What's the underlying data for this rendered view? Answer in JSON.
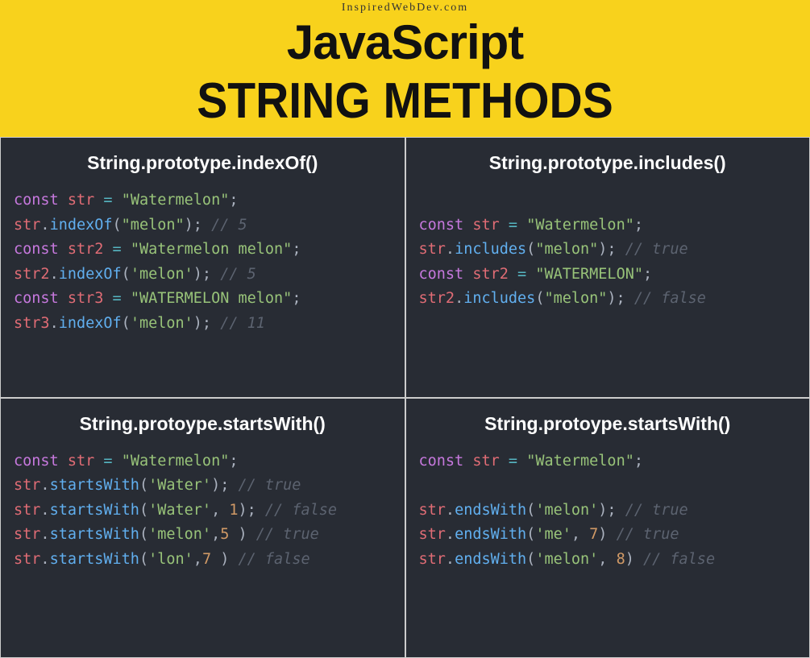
{
  "header": {
    "source": "InspiredWebDev.com",
    "title1": "JavaScript",
    "title2": "STRING METHODS"
  },
  "panels": [
    {
      "title": "String.prototype.indexOf()",
      "lines": [
        [
          [
            "kw",
            "const"
          ],
          [
            "punc",
            " "
          ],
          [
            "var",
            "str"
          ],
          [
            "punc",
            " "
          ],
          [
            "op",
            "="
          ],
          [
            "punc",
            " "
          ],
          [
            "str",
            "\"Watermelon\""
          ],
          [
            "punc",
            ";"
          ]
        ],
        [
          [
            "var",
            "str"
          ],
          [
            "punc",
            "."
          ],
          [
            "fn",
            "indexOf"
          ],
          [
            "punc",
            "("
          ],
          [
            "str",
            "\"melon\""
          ],
          [
            "punc",
            ");"
          ],
          [
            "punc",
            " "
          ],
          [
            "cmt",
            "// 5"
          ]
        ],
        [
          [
            "kw",
            "const"
          ],
          [
            "punc",
            " "
          ],
          [
            "var",
            "str2"
          ],
          [
            "punc",
            " "
          ],
          [
            "op",
            "="
          ],
          [
            "punc",
            " "
          ],
          [
            "str",
            "\"Watermelon melon\""
          ],
          [
            "punc",
            ";"
          ]
        ],
        [
          [
            "var",
            "str2"
          ],
          [
            "punc",
            "."
          ],
          [
            "fn",
            "indexOf"
          ],
          [
            "punc",
            "("
          ],
          [
            "str",
            "'melon'"
          ],
          [
            "punc",
            ");"
          ],
          [
            "punc",
            " "
          ],
          [
            "cmt",
            "// 5"
          ]
        ],
        [
          [
            "kw",
            "const"
          ],
          [
            "punc",
            " "
          ],
          [
            "var",
            "str3"
          ],
          [
            "punc",
            " "
          ],
          [
            "op",
            "="
          ],
          [
            "punc",
            " "
          ],
          [
            "str",
            "\"WATERMELON melon\""
          ],
          [
            "punc",
            ";"
          ]
        ],
        [
          [
            "var",
            "str3"
          ],
          [
            "punc",
            "."
          ],
          [
            "fn",
            "indexOf"
          ],
          [
            "punc",
            "("
          ],
          [
            "str",
            "'melon'"
          ],
          [
            "punc",
            ");"
          ],
          [
            "punc",
            " "
          ],
          [
            "cmt",
            "// 11"
          ]
        ]
      ]
    },
    {
      "title": "String.prototype.includes()",
      "lines": [
        [
          [
            "punc",
            ""
          ]
        ],
        [
          [
            "kw",
            "const"
          ],
          [
            "punc",
            " "
          ],
          [
            "var",
            "str"
          ],
          [
            "punc",
            " "
          ],
          [
            "op",
            "="
          ],
          [
            "punc",
            " "
          ],
          [
            "str",
            "\"Watermelon\""
          ],
          [
            "punc",
            ";"
          ]
        ],
        [
          [
            "var",
            "str"
          ],
          [
            "punc",
            "."
          ],
          [
            "fn",
            "includes"
          ],
          [
            "punc",
            "("
          ],
          [
            "str",
            "\"melon\""
          ],
          [
            "punc",
            ");"
          ],
          [
            "punc",
            " "
          ],
          [
            "cmt",
            "// true"
          ]
        ],
        [
          [
            "kw",
            "const"
          ],
          [
            "punc",
            " "
          ],
          [
            "var",
            "str2"
          ],
          [
            "punc",
            " "
          ],
          [
            "op",
            "="
          ],
          [
            "punc",
            " "
          ],
          [
            "str",
            "\"WATERMELON\""
          ],
          [
            "punc",
            ";"
          ]
        ],
        [
          [
            "var",
            "str2"
          ],
          [
            "punc",
            "."
          ],
          [
            "fn",
            "includes"
          ],
          [
            "punc",
            "("
          ],
          [
            "str",
            "\"melon\""
          ],
          [
            "punc",
            ");"
          ],
          [
            "punc",
            " "
          ],
          [
            "cmt",
            "// false"
          ]
        ]
      ]
    },
    {
      "title": "String.protoype.startsWith()",
      "lines": [
        [
          [
            "kw",
            "const"
          ],
          [
            "punc",
            " "
          ],
          [
            "var",
            "str"
          ],
          [
            "punc",
            " "
          ],
          [
            "op",
            "="
          ],
          [
            "punc",
            " "
          ],
          [
            "str",
            "\"Watermelon\""
          ],
          [
            "punc",
            ";"
          ]
        ],
        [
          [
            "var",
            "str"
          ],
          [
            "punc",
            "."
          ],
          [
            "fn",
            "startsWith"
          ],
          [
            "punc",
            "("
          ],
          [
            "str",
            "'Water'"
          ],
          [
            "punc",
            ");"
          ],
          [
            "punc",
            " "
          ],
          [
            "cmt",
            "// true"
          ]
        ],
        [
          [
            "var",
            "str"
          ],
          [
            "punc",
            "."
          ],
          [
            "fn",
            "startsWith"
          ],
          [
            "punc",
            "("
          ],
          [
            "str",
            "'Water'"
          ],
          [
            "punc",
            ", "
          ],
          [
            "num",
            "1"
          ],
          [
            "punc",
            ");"
          ],
          [
            "punc",
            " "
          ],
          [
            "cmt",
            "// false"
          ]
        ],
        [
          [
            "var",
            "str"
          ],
          [
            "punc",
            "."
          ],
          [
            "fn",
            "startsWith"
          ],
          [
            "punc",
            "("
          ],
          [
            "str",
            "'melon'"
          ],
          [
            "punc",
            ","
          ],
          [
            "num",
            "5"
          ],
          [
            "punc",
            " )"
          ],
          [
            "punc",
            " "
          ],
          [
            "cmt",
            "// true"
          ]
        ],
        [
          [
            "var",
            "str"
          ],
          [
            "punc",
            "."
          ],
          [
            "fn",
            "startsWith"
          ],
          [
            "punc",
            "("
          ],
          [
            "str",
            "'lon'"
          ],
          [
            "punc",
            ","
          ],
          [
            "num",
            "7"
          ],
          [
            "punc",
            " )"
          ],
          [
            "punc",
            " "
          ],
          [
            "cmt",
            "// false"
          ]
        ]
      ]
    },
    {
      "title": "String.protoype.startsWith()",
      "lines": [
        [
          [
            "kw",
            "const"
          ],
          [
            "punc",
            " "
          ],
          [
            "var",
            "str"
          ],
          [
            "punc",
            " "
          ],
          [
            "op",
            "="
          ],
          [
            "punc",
            " "
          ],
          [
            "str",
            "\"Watermelon\""
          ],
          [
            "punc",
            ";"
          ]
        ],
        [
          [
            "punc",
            ""
          ]
        ],
        [
          [
            "var",
            "str"
          ],
          [
            "punc",
            "."
          ],
          [
            "fn",
            "endsWith"
          ],
          [
            "punc",
            "("
          ],
          [
            "str",
            "'melon'"
          ],
          [
            "punc",
            ");"
          ],
          [
            "punc",
            " "
          ],
          [
            "cmt",
            "// true"
          ]
        ],
        [
          [
            "var",
            "str"
          ],
          [
            "punc",
            "."
          ],
          [
            "fn",
            "endsWith"
          ],
          [
            "punc",
            "("
          ],
          [
            "str",
            "'me'"
          ],
          [
            "punc",
            ", "
          ],
          [
            "num",
            "7"
          ],
          [
            "punc",
            ")"
          ],
          [
            "punc",
            " "
          ],
          [
            "cmt",
            "// true"
          ]
        ],
        [
          [
            "var",
            "str"
          ],
          [
            "punc",
            "."
          ],
          [
            "fn",
            "endsWith"
          ],
          [
            "punc",
            "("
          ],
          [
            "str",
            "'melon'"
          ],
          [
            "punc",
            ", "
          ],
          [
            "num",
            "8"
          ],
          [
            "punc",
            ")"
          ],
          [
            "punc",
            " "
          ],
          [
            "cmt",
            "// false"
          ]
        ]
      ]
    }
  ]
}
